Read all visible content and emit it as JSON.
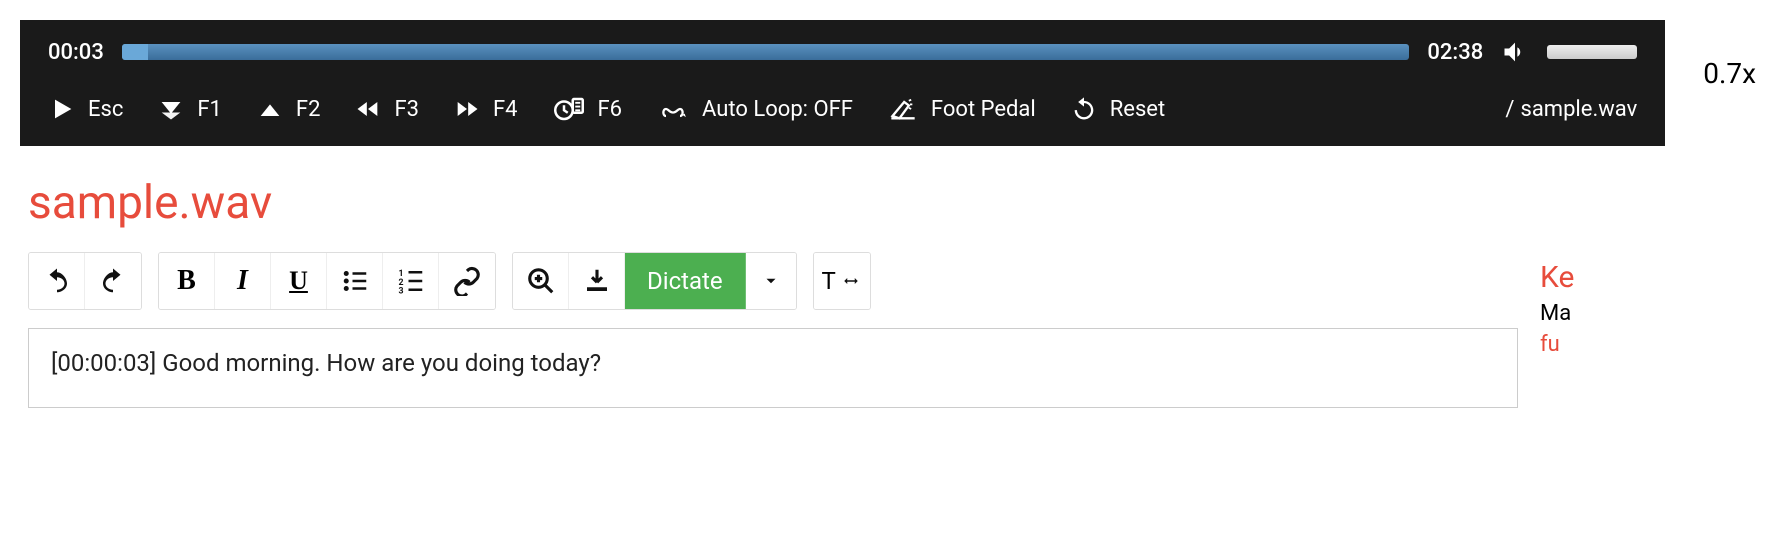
{
  "player": {
    "current_time": "00:03",
    "total_time": "02:38",
    "progress_percent": 2,
    "speed": "0.7x"
  },
  "controls": {
    "play_key": "Esc",
    "skip_back_key": "F1",
    "skip_fwd_key": "F2",
    "rewind_key": "F3",
    "ffwd_key": "F4",
    "timestamp_key": "F6",
    "autoloop_label": "Auto Loop: OFF",
    "footpedal_label": "Foot Pedal",
    "reset_label": "Reset"
  },
  "file": {
    "path_prefix": "/",
    "name": "sample.wav",
    "title": "sample.wav"
  },
  "toolbar": {
    "bold_glyph": "B",
    "italic_glyph": "I",
    "underline_glyph": "U",
    "dictate_label": "Dictate",
    "text_width_glyph": "T"
  },
  "editor": {
    "content": "[00:00:03] Good morning. How are you doing today?"
  },
  "sidebar": {
    "heading": "Ke",
    "line_black": "Ma",
    "line_red": "fu"
  },
  "colors": {
    "accent_red": "#e74c3c",
    "accent_green": "#4caf50",
    "player_bg": "#1a1a1a",
    "progress_blue": "#5a91bf"
  }
}
